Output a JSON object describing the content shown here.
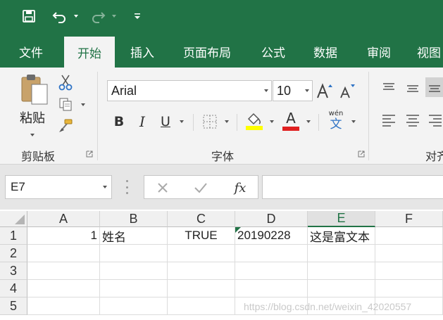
{
  "tabs": [
    {
      "label": "文件"
    },
    {
      "label": "开始"
    },
    {
      "label": "插入"
    },
    {
      "label": "页面布局"
    },
    {
      "label": "公式"
    },
    {
      "label": "数据"
    },
    {
      "label": "审阅"
    },
    {
      "label": "视图"
    }
  ],
  "active_tab": "开始",
  "ribbon": {
    "clipboard": {
      "group_label": "剪贴板",
      "paste_label": "粘贴"
    },
    "font": {
      "group_label": "字体",
      "font_name": "Arial",
      "font_size": "10",
      "bold": "B",
      "italic": "I",
      "underline": "U",
      "font_color_glyph": "A",
      "phonetic_top": "wén",
      "phonetic_char": "文"
    },
    "alignment": {
      "group_label_partial": "对齐"
    }
  },
  "formula_bar": {
    "name_box": "E7",
    "fx": "fx",
    "formula": ""
  },
  "grid": {
    "columns": [
      "A",
      "B",
      "C",
      "D",
      "E",
      "F"
    ],
    "selected_column": "E",
    "rows": [
      "1",
      "2",
      "3",
      "4",
      "5"
    ],
    "row1": {
      "A": "1",
      "B": "姓名",
      "C": "TRUE",
      "D": "20190228",
      "E": "这是富文本"
    }
  },
  "watermark": "https://blog.csdn.net/weixin_42020557",
  "colors": {
    "accent": "#217346",
    "highlight_yellow": "#ffff00",
    "font_red": "#e02020",
    "error_triangle": "#217346"
  }
}
